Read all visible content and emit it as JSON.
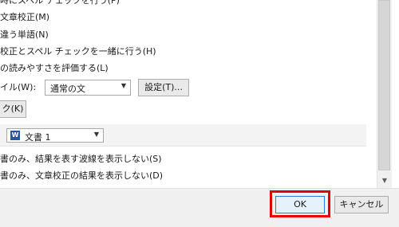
{
  "options": {
    "check_spelling_while_typing": "時にスペル チェックを行う(P)",
    "mark_grammar_errors": "文章校正(M)",
    "frequently_confused_words": "違う単語(N)",
    "check_grammar_with_spelling": "校正とスペル チェックを一緒に行う(H)",
    "show_readability": "の読みやすさを評価する(L)"
  },
  "writing_style": {
    "label": "イル(W):",
    "selected": "通常の文",
    "settings_button": "設定(T)..."
  },
  "recheck_button": "ク(K)",
  "exceptions": {
    "document_selected": "文書 1",
    "hide_spelling_errors": "書のみ、結果を表す波線を表示しない(S)",
    "hide_grammar_errors": "書のみ、文章校正の結果を表示しない(D)"
  },
  "footer": {
    "ok_label": "OK",
    "cancel_label": "キャンセル"
  },
  "colors": {
    "highlight": "#e00000"
  }
}
